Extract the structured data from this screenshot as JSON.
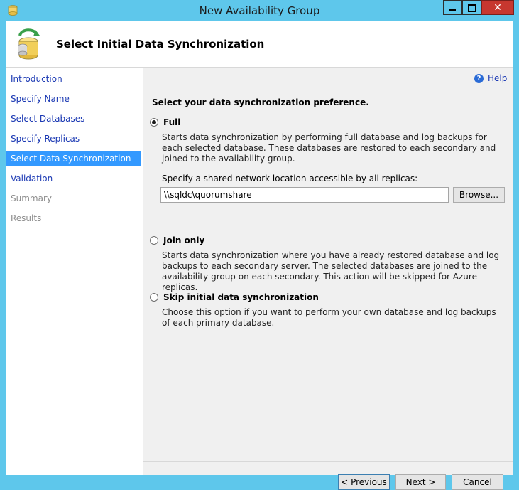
{
  "window": {
    "title": "New Availability Group",
    "controls": {
      "minimize": "minimize",
      "maximize": "maximize",
      "close": "✕"
    }
  },
  "header": {
    "title": "Select Initial Data Synchronization"
  },
  "sidebar": {
    "items": [
      {
        "label": "Introduction",
        "state": "link"
      },
      {
        "label": "Specify Name",
        "state": "link"
      },
      {
        "label": "Select Databases",
        "state": "link"
      },
      {
        "label": "Specify Replicas",
        "state": "link"
      },
      {
        "label": "Select Data Synchronization",
        "state": "active"
      },
      {
        "label": "Validation",
        "state": "link"
      },
      {
        "label": "Summary",
        "state": "disabled"
      },
      {
        "label": "Results",
        "state": "disabled"
      }
    ]
  },
  "main": {
    "help_label": "Help",
    "prompt": "Select your data synchronization preference.",
    "options": [
      {
        "label": "Full",
        "selected": true,
        "description": "Starts data synchronization by performing full database and log backups for each selected database. These databases are restored to each secondary and joined to the availability group."
      },
      {
        "label": "Join only",
        "selected": false,
        "description": "Starts data synchronization where you have already restored database and log backups to each secondary server. The selected databases are joined to the availability group on each secondary. This action will be skipped for Azure replicas."
      },
      {
        "label": "Skip initial data synchronization",
        "selected": false,
        "description": "Choose this option if you want to perform your own database and log backups of each primary database."
      }
    ],
    "share": {
      "label": "Specify a shared network location accessible by all replicas:",
      "value": "\\\\sqldc\\quorumshare",
      "browse_label": "Browse..."
    }
  },
  "footer": {
    "previous_label": "< Previous",
    "next_label": "Next >",
    "cancel_label": "Cancel"
  },
  "colors": {
    "titlebar": "#5ec7eb",
    "link": "#1a38b3",
    "active_nav": "#3399ff",
    "close_button": "#c7372f"
  }
}
